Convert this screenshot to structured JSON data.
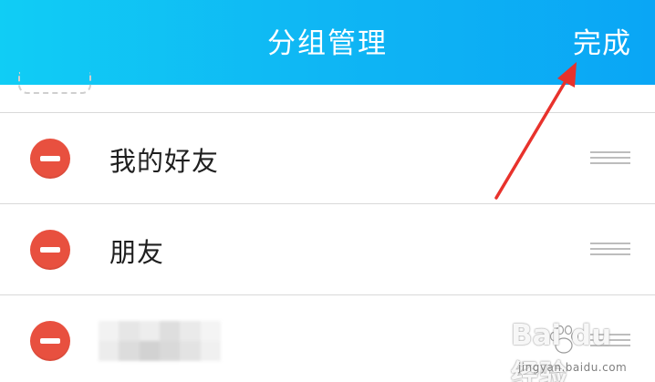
{
  "header": {
    "title": "分组管理",
    "done_label": "完成"
  },
  "groups": [
    {
      "name": "我的好友"
    },
    {
      "name": "朋友"
    },
    {
      "name": ""
    }
  ],
  "watermark": {
    "brand": "Bai du 经验",
    "url": "jingyan.baidu.com"
  },
  "colors": {
    "header_start": "#10cdf5",
    "header_end": "#0aa6f5",
    "delete": "#e8503f",
    "annotation_arrow": "#e8322c"
  },
  "icons": {
    "delete": "minus-circle-icon",
    "reorder": "drag-handle-icon",
    "annotation": "red-arrow"
  }
}
